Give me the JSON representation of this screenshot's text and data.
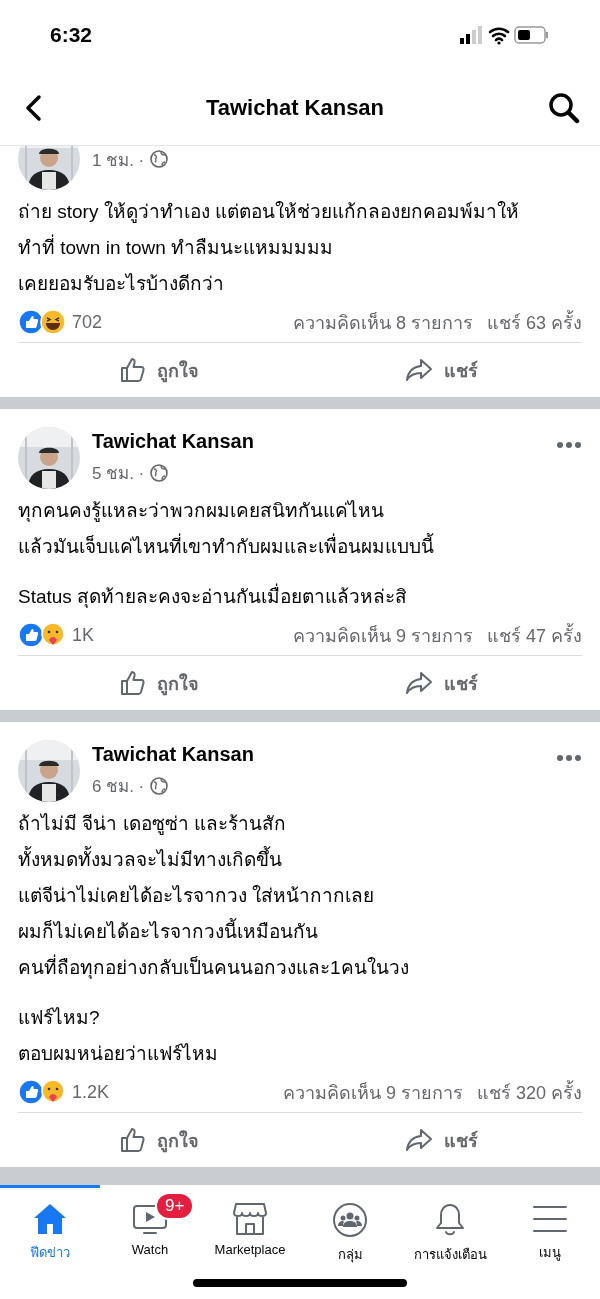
{
  "status_bar": {
    "time": "6:32"
  },
  "header": {
    "title": "Tawichat Kansan"
  },
  "posts": [
    {
      "time": "1 ชม. ·",
      "text": "ถ่าย story ให้ดูว่าทำเอง แต่ตอนให้ช่วยแก้กลองยกคอมพ์มาให้\nทำที่ town in town  ทำลืมนะแหมมมมม\nเคยยอมรับอะไรบ้างดีกว่า",
      "reactions": [
        {
          "kind": "like"
        },
        {
          "kind": "haha"
        }
      ],
      "reaction_count": "702",
      "comments": "ความคิดเห็น 8 รายการ",
      "shares": "แชร์ 63 ครั้ง",
      "like_label": "ถูกใจ",
      "share_label": "แชร์"
    },
    {
      "name": "Tawichat Kansan",
      "time": "5 ชม. ·",
      "text": "ทุกคนคงรู้แหละว่าพวกผมเคยสนิทกันแค่ไหน\nแล้วมันเจ็บแค่ไหนที่เขาทำกับผมและเพื่อนผมแบบนี้\n\nStatus สุดท้ายละคงจะอ่านกันเมื่อยตาแล้วหล่ะสิ",
      "reactions": [
        {
          "kind": "like"
        },
        {
          "kind": "care"
        }
      ],
      "reaction_count": "1K",
      "comments": "ความคิดเห็น 9 รายการ",
      "shares": "แชร์ 47 ครั้ง",
      "like_label": "ถูกใจ",
      "share_label": "แชร์"
    },
    {
      "name": "Tawichat Kansan",
      "time": "6 ชม. ·",
      "text": "ถ้าไม่มี จีน่า เดอซูซ่า และร้านสัก\nทั้งหมดทั้งมวลจะไม่มีทางเกิดขึ้น\nแต่จีน่าไม่เคยได้อะไรจากวง ใส่หน้ากากเลย\nผมก็ไม่เคยได้อะไรจากวงนี้เหมือนกัน\nคนที่ถือทุกอย่างกลับเป็นคนนอกวงและ1คนในวง\n\nแฟร์ไหม?\nตอบผมหน่อยว่าแฟร์ไหม",
      "reactions": [
        {
          "kind": "like"
        },
        {
          "kind": "care"
        }
      ],
      "reaction_count": "1.2K",
      "comments": "ความคิดเห็น 9 รายการ",
      "shares": "แชร์ 320 ครั้ง",
      "like_label": "ถูกใจ",
      "share_label": "แชร์"
    }
  ],
  "tab_bar": [
    {
      "kind": "home",
      "label": "ฟีดข่าว",
      "selected": true
    },
    {
      "kind": "watch",
      "label": "Watch",
      "selected": false,
      "badge": "9+"
    },
    {
      "kind": "marketplace",
      "label": "Marketplace",
      "selected": false
    },
    {
      "kind": "groups",
      "label": "กลุ่ม",
      "selected": false
    },
    {
      "kind": "notifications",
      "label": "การแจ้งเตือน",
      "selected": false
    },
    {
      "kind": "menu",
      "label": "เมนู",
      "selected": false
    }
  ]
}
